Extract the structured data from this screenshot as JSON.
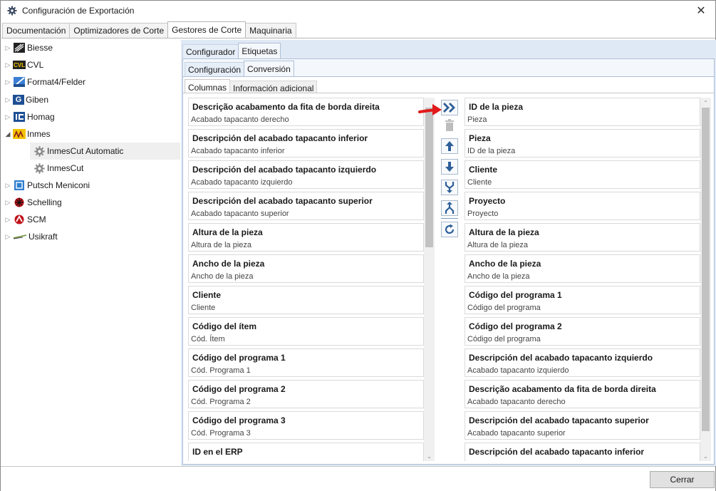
{
  "window": {
    "title": "Configuración de Exportación",
    "close_glyph": "✕"
  },
  "main_tabs": [
    {
      "label": "Documentación"
    },
    {
      "label": "Optimizadores de Corte"
    },
    {
      "label": "Gestores de Corte"
    },
    {
      "label": "Maquinaria"
    }
  ],
  "tree": {
    "items": [
      {
        "label": "Biesse",
        "logo": "biesse-logo"
      },
      {
        "label": "CVL",
        "logo": "cvl-logo",
        "logo_text": "CVL"
      },
      {
        "label": "Format4/Felder",
        "logo": "format4-logo"
      },
      {
        "label": "Giben",
        "logo": "giben-logo",
        "logo_text": "G"
      },
      {
        "label": "Homag",
        "logo": "homag-logo"
      },
      {
        "label": "Inmes",
        "logo": "inmes-logo"
      },
      {
        "label": "InmesCut Automatic",
        "logo": "gear-icon"
      },
      {
        "label": "InmesCut",
        "logo": "gear-icon"
      },
      {
        "label": "Putsch Meniconi",
        "logo": "putsch-logo"
      },
      {
        "label": "Schelling",
        "logo": "schelling-logo"
      },
      {
        "label": "SCM",
        "logo": "scm-logo"
      },
      {
        "label": "Usikraft",
        "logo": "usikraft-logo"
      }
    ]
  },
  "panel_tabs": [
    {
      "label": "Configurador"
    },
    {
      "label": "Etiquetas"
    }
  ],
  "etiquetas_tabs": [
    {
      "label": "Configuración"
    },
    {
      "label": "Conversión"
    }
  ],
  "conversion_tabs": [
    {
      "label": "Columnas"
    },
    {
      "label": "Información adicional"
    }
  ],
  "available_columns": [
    {
      "title": "Descrição acabamento da fita de borda direita",
      "subtitle": "Acabado tapacanto derecho"
    },
    {
      "title": "Descripción del acabado tapacanto inferior",
      "subtitle": "Acabado tapacanto inferior"
    },
    {
      "title": "Descripción del acabado tapacanto izquierdo",
      "subtitle": "Acabado tapacanto izquierdo"
    },
    {
      "title": "Descripción del acabado tapacanto superior",
      "subtitle": "Acabado tapacanto superior"
    },
    {
      "title": "Altura de la pieza",
      "subtitle": "Altura de la pieza"
    },
    {
      "title": "Ancho de la pieza",
      "subtitle": "Ancho de la pieza"
    },
    {
      "title": "Cliente",
      "subtitle": "Cliente"
    },
    {
      "title": "Código del ítem",
      "subtitle": "Cód. Ítem"
    },
    {
      "title": "Código del programa 1",
      "subtitle": "Cód. Programa 1"
    },
    {
      "title": "Código del programa 2",
      "subtitle": "Cód. Programa 2"
    },
    {
      "title": "Código del programa 3",
      "subtitle": "Cód. Programa 3"
    },
    {
      "title": "ID en el ERP",
      "subtitle": ""
    }
  ],
  "selected_columns": [
    {
      "title": "ID de la pieza",
      "subtitle": "Pieza"
    },
    {
      "title": "Pieza",
      "subtitle": "ID de la pieza"
    },
    {
      "title": "Cliente",
      "subtitle": "Cliente"
    },
    {
      "title": "Proyecto",
      "subtitle": "Proyecto"
    },
    {
      "title": "Altura de la pieza",
      "subtitle": "Altura de la pieza"
    },
    {
      "title": "Ancho de la pieza",
      "subtitle": "Ancho de la pieza"
    },
    {
      "title": "Código del programa 1",
      "subtitle": "Código del programa"
    },
    {
      "title": "Código del programa 2",
      "subtitle": "Código del programa"
    },
    {
      "title": "Descripción del acabado tapacanto izquierdo",
      "subtitle": "Acabado tapacanto izquierdo"
    },
    {
      "title": "Descrição acabamento da fita de borda direita",
      "subtitle": "Acabado tapacanto derecho"
    },
    {
      "title": "Descripción del acabado tapacanto superior",
      "subtitle": "Acabado tapacanto superior"
    },
    {
      "title": "Descripción del acabado tapacanto inferior",
      "subtitle": ""
    }
  ],
  "toolbar": {
    "icons": [
      "add-all-icon",
      "delete-icon",
      "move-up-icon",
      "move-down-icon",
      "merge-icon",
      "split-icon",
      "refresh-icon"
    ],
    "accent": "#2d5f99",
    "arrow_color": "#e11a1a"
  },
  "footer": {
    "close_label": "Cerrar"
  }
}
